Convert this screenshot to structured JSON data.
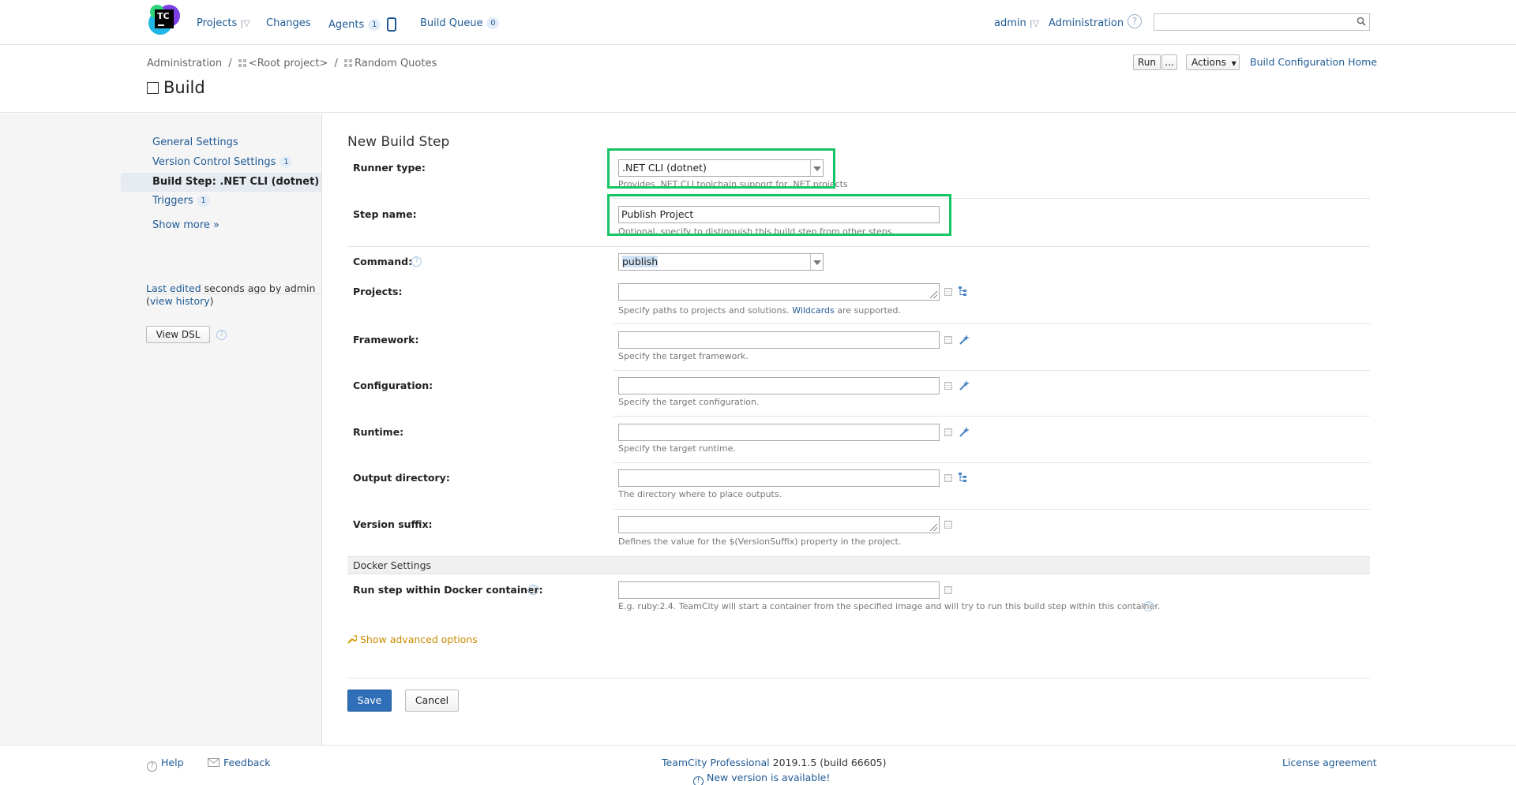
{
  "nav": {
    "projects": "Projects",
    "changes": "Changes",
    "agents": "Agents",
    "agents_count": "1",
    "build_queue": "Build Queue",
    "build_queue_count": "0",
    "user": "admin",
    "administration": "Administration",
    "search_placeholder": ""
  },
  "breadcrumb": {
    "items": [
      "Administration",
      "<Root project>",
      "Random Quotes"
    ],
    "separator": "/"
  },
  "toolbar": {
    "run": "Run",
    "more": "...",
    "actions": "Actions",
    "home": "Build Configuration Home"
  },
  "page_title": "Build",
  "sidebar": {
    "general": "General Settings",
    "vcs": "Version Control Settings",
    "vcs_count": "1",
    "build_step": "Build Step: .NET CLI (dotnet)",
    "triggers": "Triggers",
    "triggers_count": "1",
    "show_more": "Show more »",
    "last_edited_link": "Last edited",
    "last_edited_text": "seconds ago by admin",
    "view_history": "view history",
    "view_dsl": "View DSL"
  },
  "form": {
    "title": "New Build Step",
    "runner_type": {
      "label": "Runner type:",
      "value": ".NET CLI (dotnet)",
      "hint": "Provides .NET CLI toolchain support for .NET projects"
    },
    "step_name": {
      "label": "Step name:",
      "value": "Publish Project",
      "hint": "Optional, specify to distinguish this build step from other steps."
    },
    "command": {
      "label": "Command:",
      "value": "publish"
    },
    "projects": {
      "label": "Projects:",
      "value": "",
      "hint_pre": "Specify paths to projects and solutions.",
      "hint_link": "Wildcards",
      "hint_post": "are supported."
    },
    "framework": {
      "label": "Framework:",
      "value": "",
      "hint": "Specify the target framework."
    },
    "configuration": {
      "label": "Configuration:",
      "value": "",
      "hint": "Specify the target configuration."
    },
    "runtime": {
      "label": "Runtime:",
      "value": "",
      "hint": "Specify the target runtime."
    },
    "output_dir": {
      "label": "Output directory:",
      "value": "",
      "hint": "The directory where to place outputs."
    },
    "version_suffix": {
      "label": "Version suffix:",
      "value": "",
      "hint": "Defines the value for the $(VersionSuffix) property in the project."
    },
    "docker_section": "Docker Settings",
    "docker": {
      "label": "Run step within Docker container:",
      "value": "",
      "hint": "E.g. ruby:2.4. TeamCity will start a container from the specified image and will try to run this build step within this container."
    },
    "advanced": "Show advanced options",
    "save": "Save",
    "cancel": "Cancel"
  },
  "footer": {
    "help": "Help",
    "feedback": "Feedback",
    "product_link": "TeamCity Professional",
    "version": "2019.1.5 (build 66605)",
    "new_version": "New version is available!",
    "license": "License agreement"
  },
  "colors": {
    "accent": "#1f5a96",
    "highlight": "#17c564",
    "primary_button": "#2f6fb8",
    "advanced_link": "#c88a00"
  }
}
